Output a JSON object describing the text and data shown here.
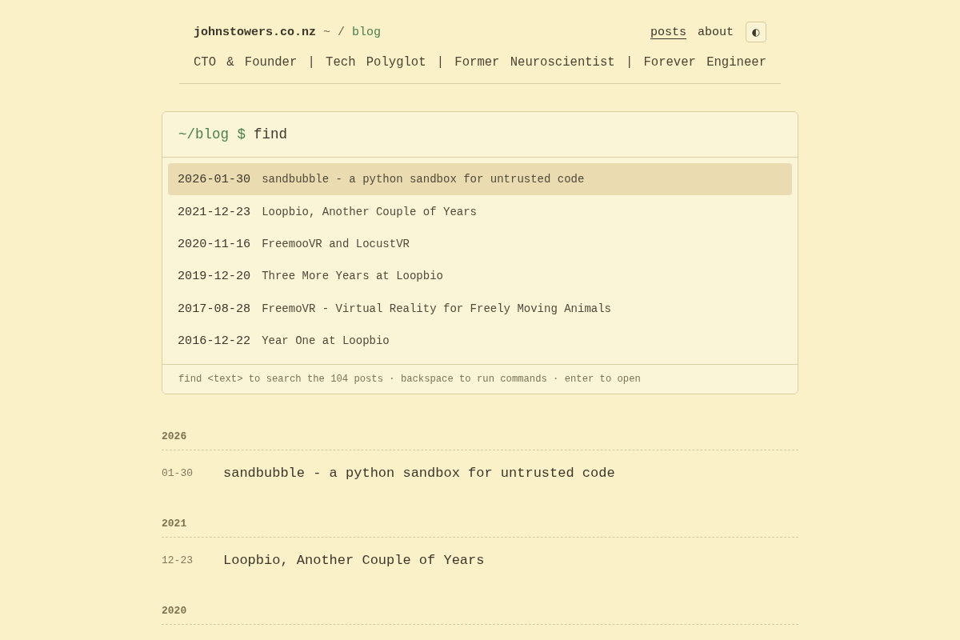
{
  "header": {
    "site": "johnstowers.co.nz",
    "separator": "~ /",
    "section": "blog",
    "nav": [
      {
        "label": "posts",
        "selected": true
      },
      {
        "label": "about",
        "selected": false
      }
    ],
    "theme_toggle": "◐",
    "tagline": "CTO & Founder | Tech Polyglot | Former Neuroscientist | Forever Engineer"
  },
  "finder": {
    "prompt": "~/blog $",
    "value": "find",
    "results": [
      {
        "date": "2026-01-30",
        "title": "sandbubble - a python sandbox for untrusted code",
        "selected": true
      },
      {
        "date": "2021-12-23",
        "title": "Loopbio, Another Couple of Years",
        "selected": false
      },
      {
        "date": "2020-11-16",
        "title": "FreemooVR and LocustVR",
        "selected": false
      },
      {
        "date": "2019-12-20",
        "title": "Three More Years at Loopbio",
        "selected": false
      },
      {
        "date": "2017-08-28",
        "title": "FreemoVR - Virtual Reality for Freely Moving Animals",
        "selected": false
      },
      {
        "date": "2016-12-22",
        "title": "Year One at Loopbio",
        "selected": false
      }
    ],
    "hint": "find <text> to search the 104 posts · backspace to run commands · enter to open"
  },
  "archive": [
    {
      "year": "2026",
      "posts": [
        {
          "date": "01-30",
          "title": "sandbubble - a python sandbox for untrusted code"
        }
      ]
    },
    {
      "year": "2021",
      "posts": [
        {
          "date": "12-23",
          "title": "Loopbio, Another Couple of Years"
        }
      ]
    },
    {
      "year": "2020"
    }
  ]
}
